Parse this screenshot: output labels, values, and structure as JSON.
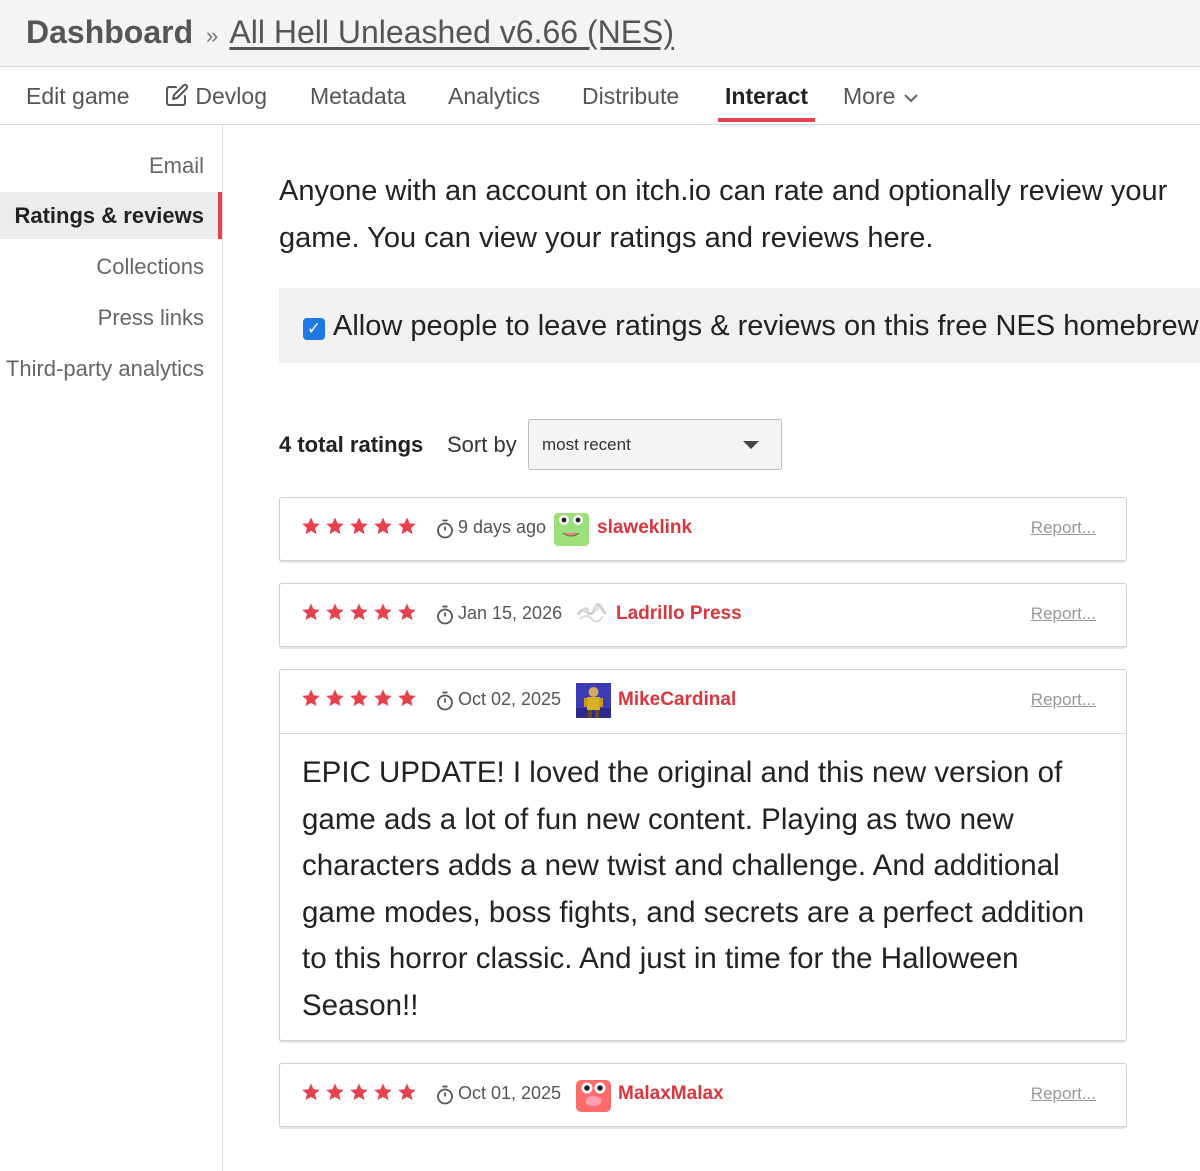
{
  "header": {
    "dashboard": "Dashboard",
    "separator": "»",
    "game_title": "All Hell Unleashed v6.66 (NES)"
  },
  "nav": {
    "edit_game": "Edit game",
    "devlog": "Devlog",
    "metadata": "Metadata",
    "analytics": "Analytics",
    "distribute": "Distribute",
    "interact": "Interact",
    "more": "More",
    "active_tab": "Interact"
  },
  "sidebar": {
    "items": [
      {
        "label": "Email"
      },
      {
        "label": "Ratings & reviews",
        "active": true
      },
      {
        "label": "Collections"
      },
      {
        "label": "Press links"
      },
      {
        "label": "Third-party analytics"
      }
    ]
  },
  "intro": {
    "line1": "Anyone with an account on itch.io can rate and optionally review your",
    "line2": "game. You can view your ratings and reviews here."
  },
  "allow": {
    "checked": true,
    "label": "Allow people to leave ratings & reviews on this free NES homebrew"
  },
  "ratings": {
    "total_label": "4 total ratings",
    "sort_label": "Sort by",
    "sort_value": "most recent",
    "items": [
      {
        "stars": 5,
        "date": "9 days ago",
        "user": "slaweklink",
        "report": "Report...",
        "review": ""
      },
      {
        "stars": 5,
        "date": "Jan 15, 2026",
        "user": "Ladrillo Press",
        "report": "Report...",
        "review": ""
      },
      {
        "stars": 5,
        "date": "Oct 02, 2025",
        "user": "MikeCardinal",
        "report": "Report...",
        "review_lines": [
          "EPIC UPDATE!  I loved the original and this new version of",
          "game ads a lot of fun new content.  Playing as two new",
          "characters adds a new twist and challenge.  And additional",
          "game modes, boss fights, and secrets are a perfect addition",
          "to this horror classic.  And just in time for the Halloween",
          "Season!!"
        ]
      },
      {
        "stars": 5,
        "date": "Oct 01, 2025",
        "user": "MalaxMalax",
        "report": "Report...",
        "review": ""
      }
    ]
  },
  "colors": {
    "accent": "#e8404e",
    "star": "#e8404e",
    "username": "#d9363e",
    "checkbox": "#1e78e6"
  }
}
